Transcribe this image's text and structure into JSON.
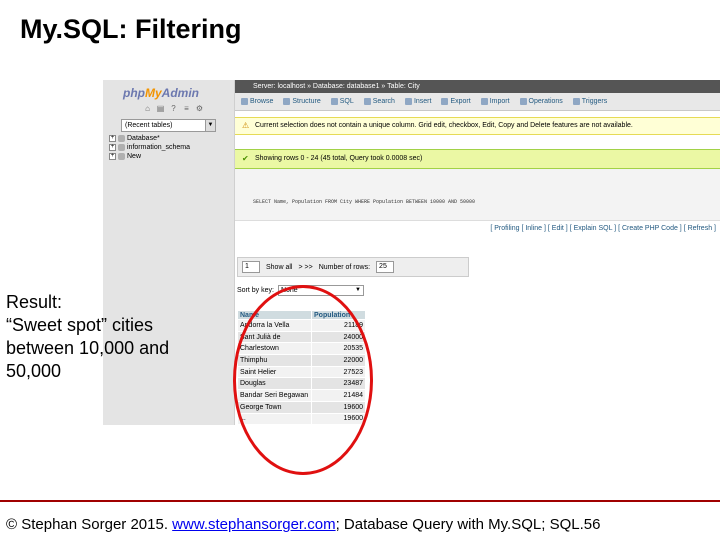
{
  "slide": {
    "title": "My.SQL: Filtering",
    "caption_lines": [
      "Result:",
      "“Sweet spot” cities",
      "between 10,000 and",
      "50,000"
    ]
  },
  "pma": {
    "logo": {
      "php": "php",
      "my": "My",
      "admin": "Admin"
    },
    "recent_tables": "(Recent tables)",
    "tree": [
      "Database*",
      "information_schema",
      "New"
    ],
    "breadcrumb": "Server: localhost » Database: database1 » Table: City",
    "tabs": [
      "Browse",
      "Structure",
      "SQL",
      "Search",
      "Insert",
      "Export",
      "Import",
      "Operations",
      "Triggers"
    ],
    "warning": "Current selection does not contain a unique column. Grid edit, checkbox, Edit, Copy and Delete features are not available.",
    "success": "Showing rows 0 - 24 (45 total, Query took 0.0008 sec)",
    "query": "SELECT Name, Population FROM City WHERE Population BETWEEN 10000 AND 50000",
    "links": "[ Profiling [ Inline ] [ Edit ] [ Explain SQL ] [ Create PHP Code ] [ Refresh ]",
    "nav": {
      "page": "1",
      "show_all": "Show all",
      "next": "> >>",
      "rows_label": "Number of rows:",
      "rows_value": "25"
    },
    "sort": {
      "label": "Sort by key:",
      "value": "None"
    },
    "table": {
      "headers": [
        "Name",
        "Population"
      ],
      "rows": [
        [
          "Andorra la Vella",
          "21189"
        ],
        [
          "Sant Julià de",
          "24000"
        ],
        [
          "Charlestown",
          "20535"
        ],
        [
          "Thimphu",
          "22000"
        ],
        [
          "Saint Helier",
          "27523"
        ],
        [
          "Douglas",
          "23487"
        ],
        [
          "Bandar Seri Begawan",
          "21484"
        ],
        [
          "George Town",
          "19600"
        ],
        [
          "...",
          "19600"
        ]
      ]
    }
  },
  "footer": {
    "prefix": "© Stephan Sorger 2015. ",
    "link": "www.stephansorger.com",
    "suffix": "; Database Query with My.SQL; SQL.56"
  }
}
